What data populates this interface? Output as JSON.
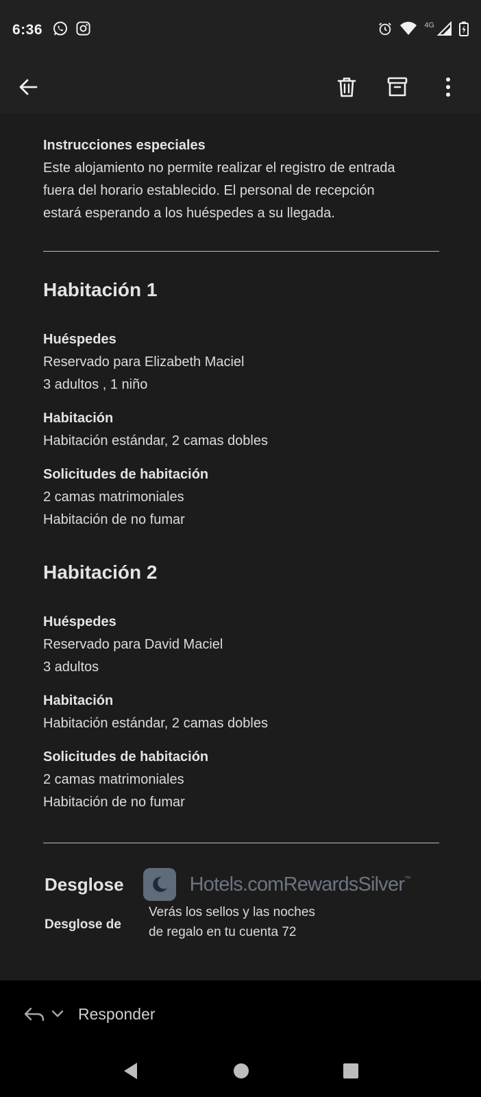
{
  "status": {
    "time": "6:36",
    "network": "4G",
    "icons_left": [
      "whatsapp-icon",
      "instagram-icon"
    ],
    "icons_right": [
      "alarm-icon",
      "wifi-icon",
      "signal-icon",
      "battery-icon"
    ]
  },
  "toolbar": {
    "back": "arrow-back-icon",
    "actions": [
      "trash-icon",
      "archive-icon",
      "more-vertical-icon"
    ]
  },
  "special": {
    "label": "Instrucciones especiales",
    "lines": [
      "Este alojamiento no permite realizar el registro de entrada",
      "fuera del horario establecido. El personal de recepción",
      "estará esperando a los huéspedes a su llegada."
    ]
  },
  "rooms": [
    {
      "title": "Habitación 1",
      "guests_label": "Huéspedes",
      "reserved_for": "Reservado para Elizabeth Maciel",
      "occupancy": "3 adultos , 1 niño",
      "room_label": "Habitación",
      "room_type": "Habitación estándar, 2 camas dobles",
      "requests_label": "Solicitudes de habitación",
      "requests": [
        "2 camas matrimoniales",
        "Habitación de no fumar"
      ]
    },
    {
      "title": "Habitación 2",
      "guests_label": "Huéspedes",
      "reserved_for": "Reservado para David Maciel",
      "occupancy": "3 adultos",
      "room_label": "Habitación",
      "room_type": "Habitación estándar, 2 camas dobles",
      "requests_label": "Solicitudes de habitación",
      "requests": [
        "2 camas matrimoniales",
        "Habitación de no fumar"
      ]
    }
  ],
  "breakdown": {
    "title": "Desglose",
    "rewards_logo_text": "Hotels.comRewardsSilver",
    "rewards_tm": "™",
    "sub_label": "Desglose de",
    "note_line1": "Verás los sellos y las noches",
    "note_line2": "de regalo en tu cuenta 72"
  },
  "reply": {
    "label": "Responder"
  },
  "nav": {
    "buttons": [
      "back-triangle-icon",
      "home-circle-icon",
      "recents-square-icon"
    ]
  },
  "colors": {
    "background": "#1c1c1d",
    "bar": "#212122",
    "text": "#e3e3e3",
    "rewards": "#6d7480",
    "rewards_badge": "#5f6b78"
  }
}
